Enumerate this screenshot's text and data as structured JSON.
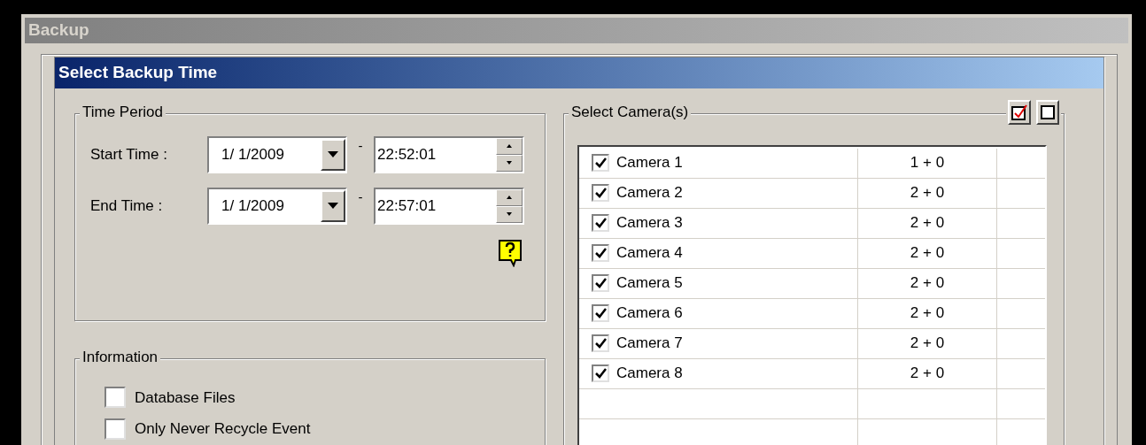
{
  "window": {
    "title": "Backup"
  },
  "panel": {
    "title": "Select Backup Time"
  },
  "time_period": {
    "title": "Time Period",
    "rows": [
      {
        "label": "Start Time :",
        "date": "1/ 1/2009",
        "separator": "-",
        "time": "22:52:01"
      },
      {
        "label": "End Time :",
        "date": "1/ 1/2009",
        "separator": "-",
        "time": "22:57:01"
      }
    ]
  },
  "information": {
    "title": "Information",
    "options": [
      {
        "label": "Database Files",
        "checked": false
      },
      {
        "label": "Only Never Recycle Event",
        "checked": false
      }
    ]
  },
  "cameras": {
    "title": "Select Camera(s)",
    "rows": [
      {
        "name": "Camera 1",
        "checked": true,
        "count": "1 + 0"
      },
      {
        "name": "Camera 2",
        "checked": true,
        "count": "2 + 0"
      },
      {
        "name": "Camera 3",
        "checked": true,
        "count": "2 + 0"
      },
      {
        "name": "Camera 4",
        "checked": true,
        "count": "2 + 0"
      },
      {
        "name": "Camera 5",
        "checked": true,
        "count": "2 + 0"
      },
      {
        "name": "Camera 6",
        "checked": true,
        "count": "2 + 0"
      },
      {
        "name": "Camera 7",
        "checked": true,
        "count": "2 + 0"
      },
      {
        "name": "Camera 8",
        "checked": true,
        "count": "2 + 0"
      }
    ]
  }
}
